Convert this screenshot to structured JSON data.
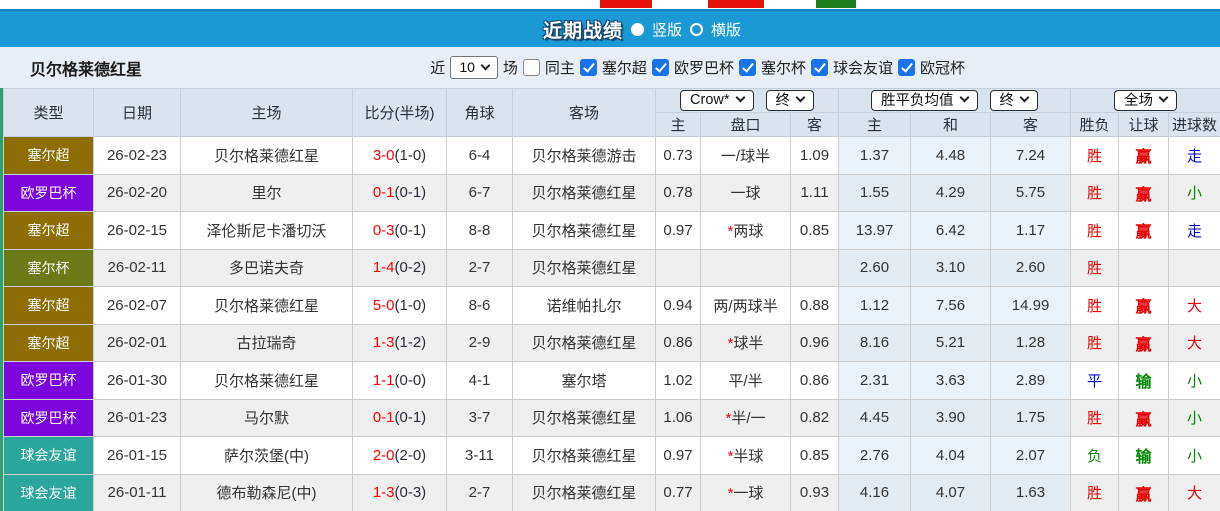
{
  "top_strip": {
    "buttons": [
      {
        "name": "red-button-1",
        "color": "#e8120e"
      },
      {
        "name": "red-button-2",
        "color": "#e8120e"
      },
      {
        "name": "green-button",
        "color": "#1e7e1e"
      }
    ]
  },
  "header_bar": {
    "title": "近期战绩",
    "layout_options": [
      {
        "label": "竖版",
        "selected": true
      },
      {
        "label": "横版",
        "selected": false
      }
    ]
  },
  "filter_bar": {
    "team_title": "贝尔格莱德红星",
    "near_label": "近",
    "match_count": "10",
    "matches_label": "场",
    "same_home": {
      "label": "同主",
      "checked": false
    },
    "leagues": [
      {
        "label": "塞尔超",
        "checked": true
      },
      {
        "label": "欧罗巴杯",
        "checked": true
      },
      {
        "label": "塞尔杯",
        "checked": true
      },
      {
        "label": "球会友谊",
        "checked": true
      },
      {
        "label": "欧冠杯",
        "checked": true
      }
    ]
  },
  "table": {
    "headers": {
      "type": "类型",
      "date": "日期",
      "home": "主场",
      "score": "比分(半场)",
      "corners": "角球",
      "away": "客场",
      "ah_home": "主",
      "ah_line": "盘口",
      "ah_away": "客",
      "odds_home": "主",
      "odds_draw": "和",
      "odds_away": "客",
      "result": "胜负",
      "handicap": "让球",
      "goals": "进球数"
    },
    "dropdowns": {
      "source": "Crow*",
      "source_final": "终",
      "avg": "胜平负均值",
      "avg_final": "终",
      "scope": "全场"
    },
    "rows": [
      {
        "league": "塞尔超",
        "league_color": "#8e6e04",
        "date": "26-02-23",
        "home": {
          "text": "贝尔格莱德红星",
          "focus": true
        },
        "score": "3-0",
        "half": "(1-0)",
        "corners": "6-4",
        "away": {
          "text": "贝尔格莱德游击",
          "focus": false
        },
        "ah_home": "0.73",
        "ah_star": "",
        "ah_line": "一/球半",
        "ah_away": "1.09",
        "odds_home": "1.37",
        "odds_draw": "4.48",
        "odds_away": "7.24",
        "result": {
          "text": "胜",
          "color": "red"
        },
        "handicap": {
          "text": "赢",
          "color": "red"
        },
        "goals": {
          "text": "走",
          "color": "blue"
        }
      },
      {
        "league": "欧罗巴杯",
        "league_color": "#7a06dd",
        "date": "26-02-20",
        "home": {
          "text": "里尔",
          "focus": false
        },
        "score": "0-1",
        "half": "(0-1)",
        "corners": "6-7",
        "away": {
          "text": "贝尔格莱德红星",
          "focus": true
        },
        "ah_home": "0.78",
        "ah_star": "",
        "ah_line": "一球",
        "ah_away": "1.11",
        "odds_home": "1.55",
        "odds_draw": "4.29",
        "odds_away": "5.75",
        "result": {
          "text": "胜",
          "color": "red"
        },
        "handicap": {
          "text": "赢",
          "color": "red"
        },
        "goals": {
          "text": "小",
          "color": "green"
        }
      },
      {
        "league": "塞尔超",
        "league_color": "#8e6e04",
        "date": "26-02-15",
        "home": {
          "text": "泽伦斯尼卡潘切沃",
          "focus": false
        },
        "score": "0-3",
        "half": "(0-1)",
        "corners": "8-8",
        "away": {
          "text": "贝尔格莱德红星",
          "focus": true
        },
        "ah_home": "0.97",
        "ah_star": "*",
        "ah_line": "两球",
        "ah_away": "0.85",
        "odds_home": "13.97",
        "odds_draw": "6.42",
        "odds_away": "1.17",
        "result": {
          "text": "胜",
          "color": "red"
        },
        "handicap": {
          "text": "赢",
          "color": "red"
        },
        "goals": {
          "text": "走",
          "color": "blue"
        }
      },
      {
        "league": "塞尔杯",
        "league_color": "#6d7a1a",
        "date": "26-02-11",
        "home": {
          "text": "多巴诺夫奇",
          "focus": false
        },
        "score": "1-4",
        "half": "(0-2)",
        "corners": "2-7",
        "away": {
          "text": "贝尔格莱德红星",
          "focus": true
        },
        "ah_home": "",
        "ah_star": "",
        "ah_line": "",
        "ah_away": "",
        "odds_home": "2.60",
        "odds_draw": "3.10",
        "odds_away": "2.60",
        "result": {
          "text": "胜",
          "color": "red"
        },
        "handicap": "",
        "goals": ""
      },
      {
        "league": "塞尔超",
        "league_color": "#8e6e04",
        "date": "26-02-07",
        "home": {
          "text": "贝尔格莱德红星",
          "focus": true
        },
        "score": "5-0",
        "half": "(1-0)",
        "corners": "8-6",
        "away": {
          "text": "诺维帕扎尔",
          "focus": false
        },
        "ah_home": "0.94",
        "ah_star": "",
        "ah_line": "两/两球半",
        "ah_away": "0.88",
        "odds_home": "1.12",
        "odds_draw": "7.56",
        "odds_away": "14.99",
        "result": {
          "text": "胜",
          "color": "red"
        },
        "handicap": {
          "text": "赢",
          "color": "red"
        },
        "goals": {
          "text": "大",
          "color": "red"
        }
      },
      {
        "league": "塞尔超",
        "league_color": "#8e6e04",
        "date": "26-02-01",
        "home": {
          "text": "古拉瑞奇",
          "focus": false
        },
        "score": "1-3",
        "half": "(1-2)",
        "corners": "2-9",
        "away": {
          "text": "贝尔格莱德红星",
          "focus": true
        },
        "ah_home": "0.86",
        "ah_star": "*",
        "ah_line": "球半",
        "ah_away": "0.96",
        "odds_home": "8.16",
        "odds_draw": "5.21",
        "odds_away": "1.28",
        "result": {
          "text": "胜",
          "color": "red"
        },
        "handicap": {
          "text": "赢",
          "color": "red"
        },
        "goals": {
          "text": "大",
          "color": "red"
        }
      },
      {
        "league": "欧罗巴杯",
        "league_color": "#7a06dd",
        "date": "26-01-30",
        "home": {
          "text": "贝尔格莱德红星",
          "focus": true
        },
        "score": "1-1",
        "half": "(0-0)",
        "corners": "4-1",
        "away": {
          "text": "塞尔塔",
          "focus": false
        },
        "ah_home": "1.02",
        "ah_star": "",
        "ah_line": "平/半",
        "ah_away": "0.86",
        "odds_home": "2.31",
        "odds_draw": "3.63",
        "odds_away": "2.89",
        "result": {
          "text": "平",
          "color": "blue"
        },
        "handicap": {
          "text": "输",
          "color": "green"
        },
        "goals": {
          "text": "小",
          "color": "green"
        }
      },
      {
        "league": "欧罗巴杯",
        "league_color": "#7a06dd",
        "date": "26-01-23",
        "home": {
          "text": "马尔默",
          "focus": false
        },
        "score": "0-1",
        "half": "(0-1)",
        "corners": "3-7",
        "away": {
          "text": "贝尔格莱德红星",
          "focus": true
        },
        "ah_home": "1.06",
        "ah_star": "*",
        "ah_line": "半/一",
        "ah_away": "0.82",
        "odds_home": "4.45",
        "odds_draw": "3.90",
        "odds_away": "1.75",
        "result": {
          "text": "胜",
          "color": "red"
        },
        "handicap": {
          "text": "赢",
          "color": "red"
        },
        "goals": {
          "text": "小",
          "color": "green"
        }
      },
      {
        "league": "球会友谊",
        "league_color": "#29a79b",
        "date": "26-01-15",
        "home": {
          "text": "萨尔茨堡(中)",
          "focus": false
        },
        "score": "2-0",
        "half": "(2-0)",
        "corners": "3-11",
        "away": {
          "text": "贝尔格莱德红星",
          "focus": true
        },
        "ah_home": "0.97",
        "ah_star": "*",
        "ah_line": "半球",
        "ah_away": "0.85",
        "odds_home": "2.76",
        "odds_draw": "4.04",
        "odds_away": "2.07",
        "result": {
          "text": "负",
          "color": "green"
        },
        "handicap": {
          "text": "输",
          "color": "green"
        },
        "goals": {
          "text": "小",
          "color": "green"
        }
      },
      {
        "league": "球会友谊",
        "league_color": "#29a79b",
        "date": "26-01-11",
        "home": {
          "text": "德布勒森尼(中)",
          "focus": false
        },
        "score": "1-3",
        "half": "(0-3)",
        "corners": "2-7",
        "away": {
          "text": "贝尔格莱德红星",
          "focus": true
        },
        "ah_home": "0.77",
        "ah_star": "*",
        "ah_line": "一球",
        "ah_away": "0.93",
        "odds_home": "4.16",
        "odds_draw": "4.07",
        "odds_away": "1.63",
        "result": {
          "text": "胜",
          "color": "red"
        },
        "handicap": {
          "text": "赢",
          "color": "red"
        },
        "goals": {
          "text": "大",
          "color": "red"
        }
      }
    ]
  },
  "colors": {
    "accent_blue": "#1b99d5",
    "league_serbia_super": "#8e6e04",
    "league_europa": "#7a06dd",
    "league_serbia_cup": "#6d7a1a",
    "league_friendly": "#29a79b",
    "focus_team_green": "#008800",
    "score_red": "#ff0000"
  }
}
